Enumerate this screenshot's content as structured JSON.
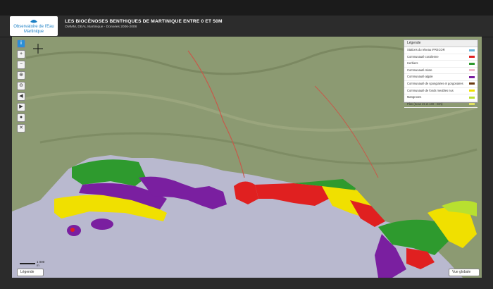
{
  "header": {
    "logo_line1": "Observatoire de l'Eau",
    "logo_line2": "Martinique",
    "title": "LES BIOCÉNOSES BENTHIQUES DE MARTINIQUE ENTRE 0 ET 50M",
    "subtitle": "OMMM, DEAL Martinique - Données 2006-2008"
  },
  "legend": {
    "heading": "Légende",
    "items": [
      {
        "label": "Stations du réseau IFRECOR",
        "color": "#6ab4d8"
      },
      {
        "label": "Communauté coralienne",
        "color": "#e02020"
      },
      {
        "label": "Herbiers",
        "color": "#2e9a2e"
      },
      {
        "label": "Communauté mixte",
        "color": "#f0b8c8"
      },
      {
        "label": "Communauté algale",
        "color": "#7a1fa0"
      },
      {
        "label": "Communauté de spongiaires et gorgonaires",
        "color": "#6b3a10"
      },
      {
        "label": "Communauté de fonds meubles nus",
        "color": "#f0e000"
      },
      {
        "label": "Mangroves",
        "color": "#b8e030"
      },
      {
        "label": "Plan (Scan 25 et 100 - IGN)",
        "color": "#dfe060"
      }
    ]
  },
  "scale_label": "1 000 m",
  "legend_button": "Légende",
  "global_view_button": "Vue globale",
  "tool_icons": [
    "info-icon",
    "zoom-in-icon",
    "zoom-out-icon",
    "zoom-box-icon",
    "zoom-box-out-icon",
    "history-back-icon",
    "history-forward-icon",
    "locate-icon",
    "tools-icon"
  ],
  "colors": {
    "sea": "#b9b9cf",
    "land": "#8c9a72",
    "coral": "#e02020",
    "seagrass": "#2e9a2e",
    "algae": "#7a1fa0",
    "sand": "#f0e000"
  }
}
